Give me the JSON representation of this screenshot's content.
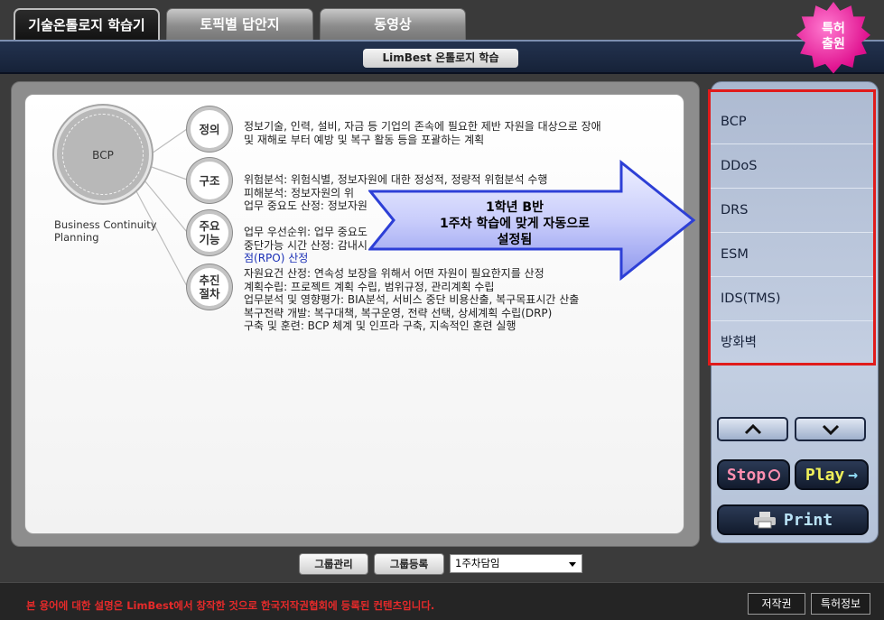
{
  "tabs": [
    {
      "label": "기술온톨로지 학습기",
      "active": true
    },
    {
      "label": "토픽별 답안지",
      "active": false
    },
    {
      "label": "동영상",
      "active": false
    }
  ],
  "badge": {
    "line1": "특허",
    "line2": "출원"
  },
  "header": {
    "title": "LimBest 온톨로지 학습"
  },
  "concept": {
    "center": "BCP",
    "subtitle_line1": "Business Continuity",
    "subtitle_line2": "Planning",
    "nodes": [
      {
        "label": "정의"
      },
      {
        "label": "구조"
      },
      {
        "label_line1": "주요",
        "label_line2": "기능"
      },
      {
        "label_line1": "추진",
        "label_line2": "절차"
      }
    ],
    "definition": [
      "정보기술, 인력, 설비, 자금 등 기업의 존속에 필요한 제반 자원을 대상으로 장애",
      "및 재해로 부터 예방 및 복구 활동 등을 포괄하는 계획"
    ],
    "structure": [
      "위험분석: 위험식별, 정보자원에 대한 정성적, 정량적 위험분석 수행",
      "피해분석: 정보자원의 위",
      "업무 중요도 산정: 정보자원"
    ],
    "functions": [
      "업무 우선순위: 업무 중요도",
      "중단가능 시간 산정: 감내시",
      "점(RPO) 산정"
    ],
    "procedure": [
      "자원요건 산정: 연속성 보장을 위해서 어떤 자원이 필요한지를 산정",
      "계획수립: 프로젝트 계획 수립, 범위규정, 관리계획 수립",
      "업무분석 및 영향평가: BIA분석, 서비스 중단 비용산출, 복구목표시간 산출",
      "복구전략 개발: 복구대책, 복구운영, 전략 선택, 상세계획 수립(DRP)",
      "구축 및 훈련: BCP 체계 및 인프라 구축, 지속적인 훈련 실행"
    ]
  },
  "overlay": {
    "line1": "1학년 B반",
    "line2": "1주차 학습에 맞게 자동으로",
    "line3": "설정됨"
  },
  "menu": {
    "items": [
      "BCP",
      "DDoS",
      "DRS",
      "ESM",
      "IDS(TMS)",
      "방화벽"
    ]
  },
  "controls": {
    "up_icon": "chevron-up-icon",
    "down_icon": "chevron-down-icon",
    "stop_label": "Stop",
    "play_label": "Play",
    "print_label": "Print"
  },
  "bottom": {
    "group_manage": "그룹관리",
    "group_register": "그룹등록",
    "select_value": "1주차담임"
  },
  "footer": {
    "note": "본 용어에 대한 설명은 LimBest에서 창작한 것으로 한국저작권협회에 등록된 컨텐츠입니다.",
    "copyright": "저작권",
    "patent": "특허정보"
  },
  "colors": {
    "highlight": "#e01b1b",
    "stop": "#ff8fb0",
    "play": "#f0f05a",
    "note": "#e52a2a"
  }
}
